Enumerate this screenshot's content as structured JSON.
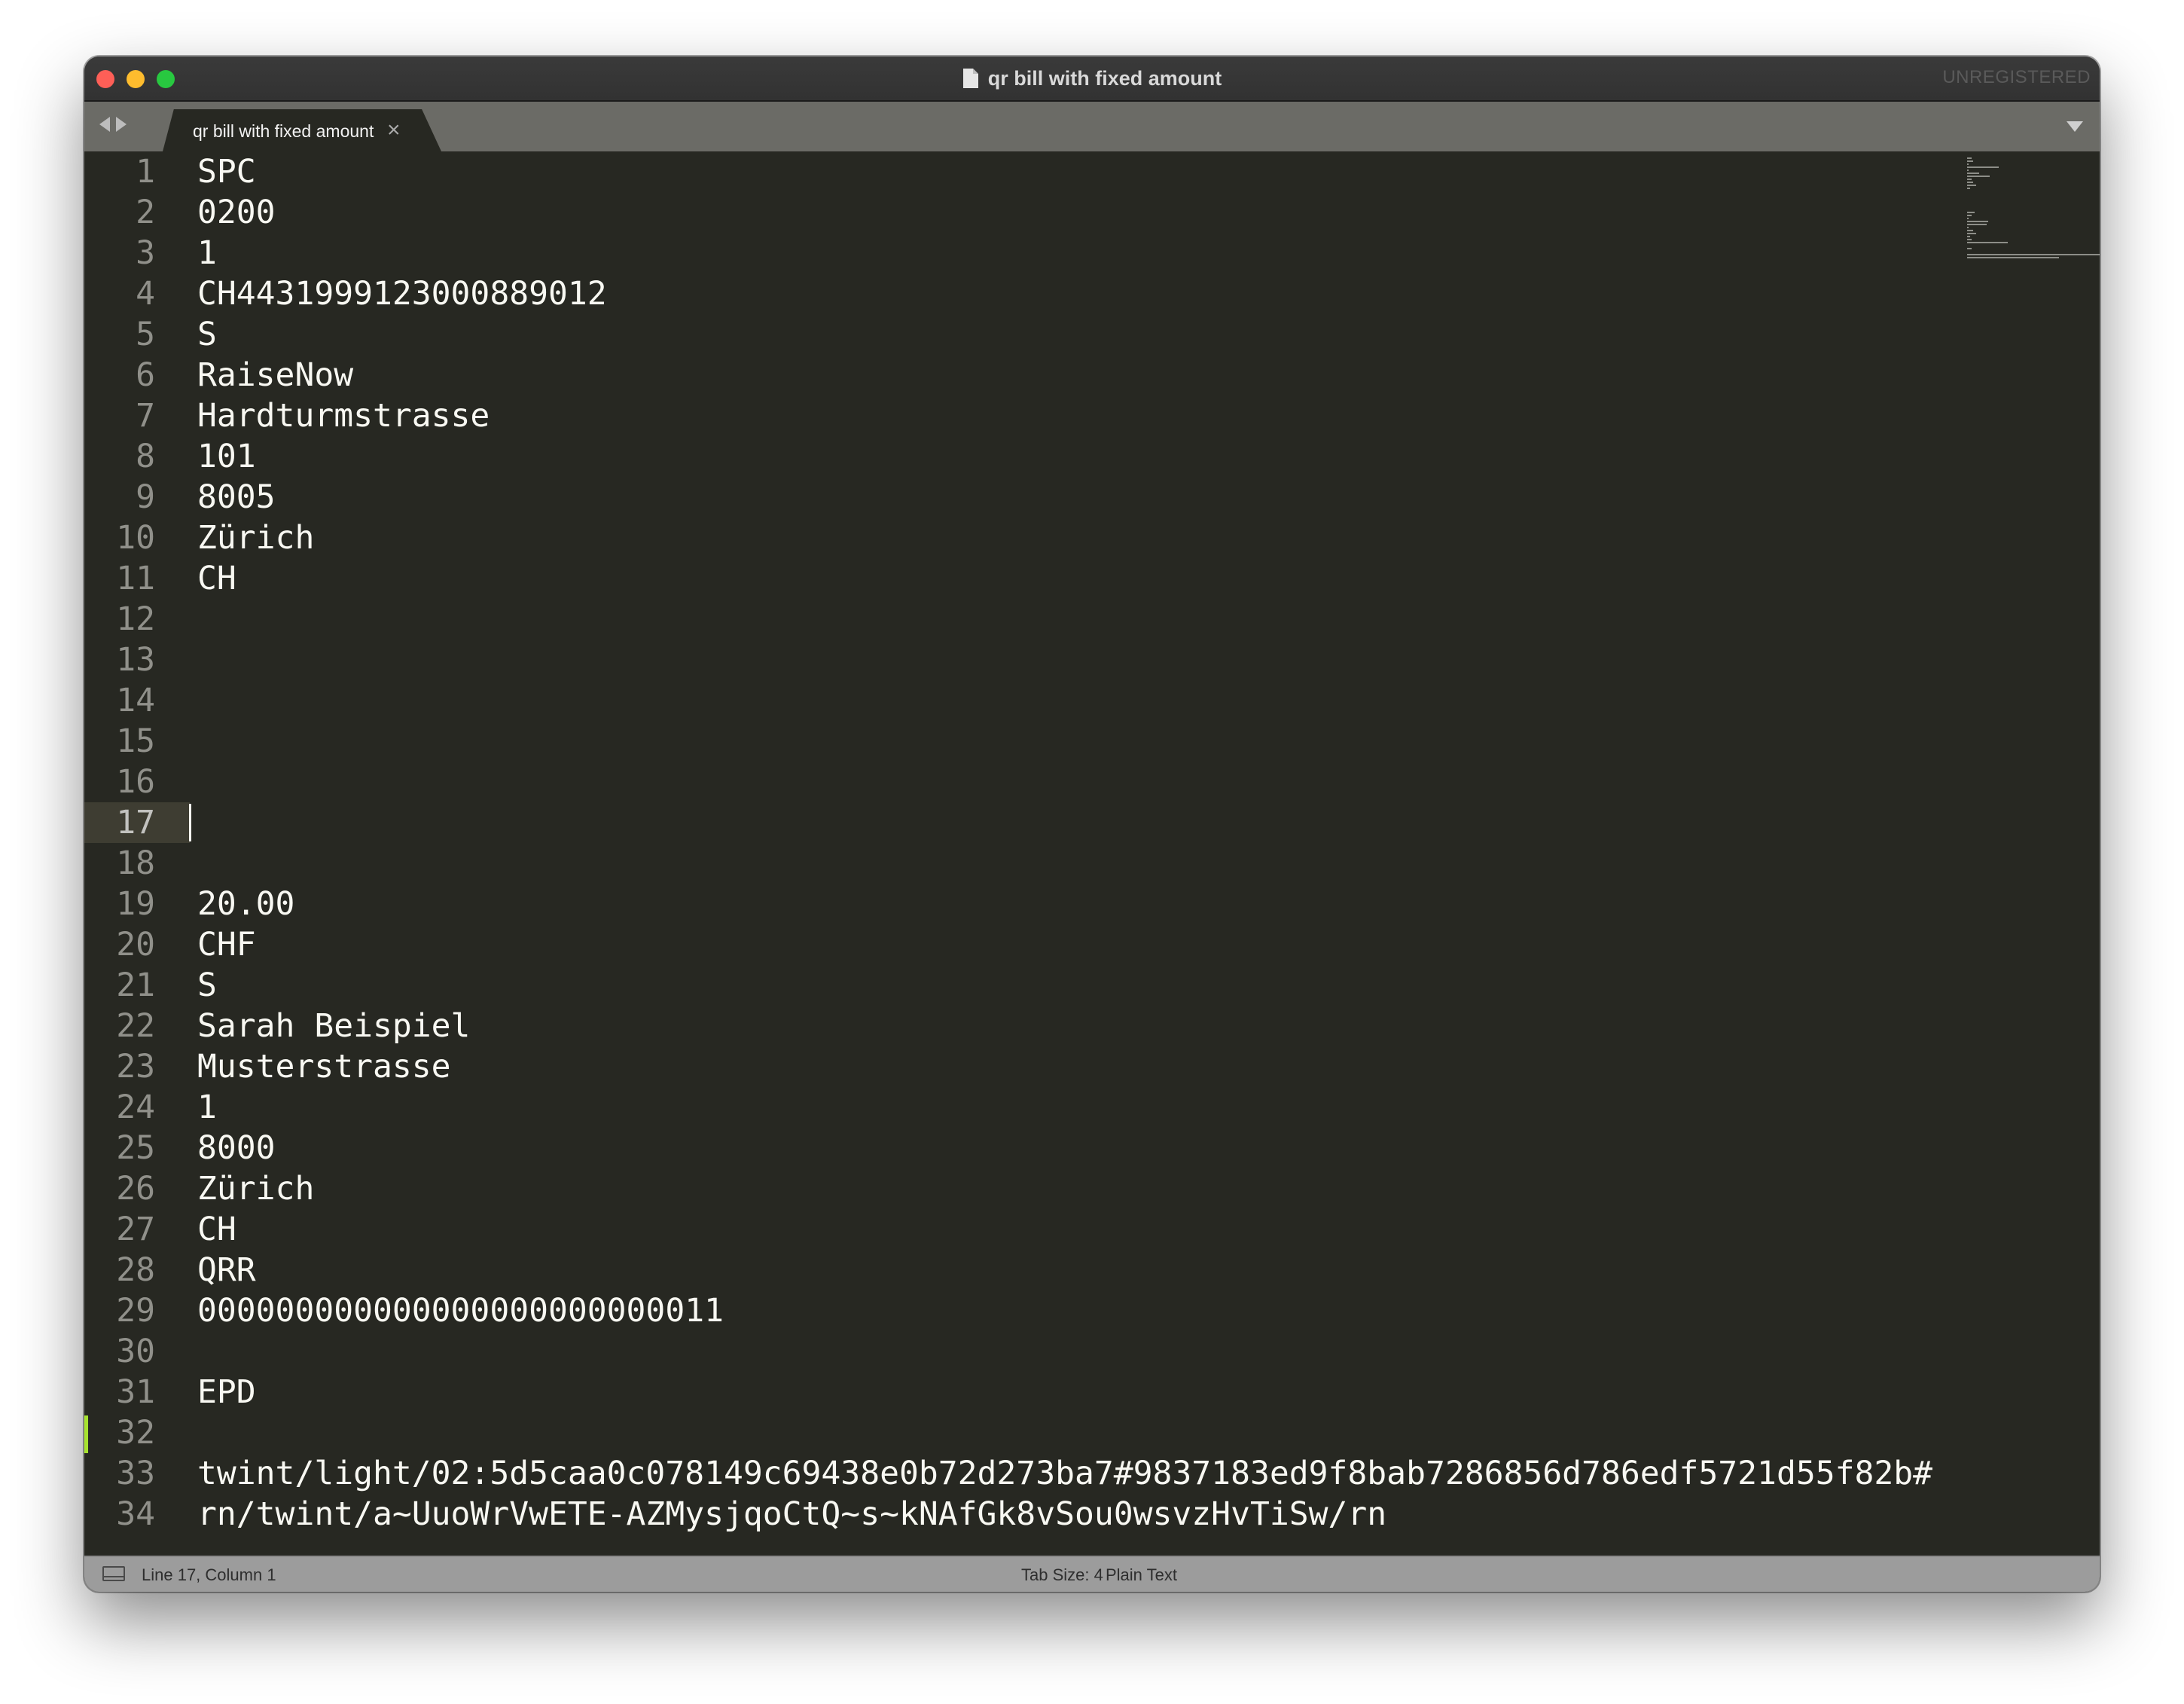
{
  "window": {
    "title": "qr bill with fixed amount",
    "unregistered_label": "UNREGISTERED"
  },
  "tabs": [
    {
      "label": "qr bill with fixed amount",
      "close_glyph": "×"
    }
  ],
  "editor": {
    "current_line": 17,
    "lines": [
      {
        "n": "1",
        "text": "SPC"
      },
      {
        "n": "2",
        "text": "0200"
      },
      {
        "n": "3",
        "text": "1"
      },
      {
        "n": "4",
        "text": "CH4431999123000889012"
      },
      {
        "n": "5",
        "text": "S"
      },
      {
        "n": "6",
        "text": "RaiseNow"
      },
      {
        "n": "7",
        "text": "Hardturmstrasse"
      },
      {
        "n": "8",
        "text": "101"
      },
      {
        "n": "9",
        "text": "8005"
      },
      {
        "n": "10",
        "text": "Zürich"
      },
      {
        "n": "11",
        "text": "CH"
      },
      {
        "n": "12",
        "text": ""
      },
      {
        "n": "13",
        "text": ""
      },
      {
        "n": "14",
        "text": ""
      },
      {
        "n": "15",
        "text": ""
      },
      {
        "n": "16",
        "text": ""
      },
      {
        "n": "17",
        "text": ""
      },
      {
        "n": "18",
        "text": ""
      },
      {
        "n": "19",
        "text": "20.00"
      },
      {
        "n": "20",
        "text": "CHF"
      },
      {
        "n": "21",
        "text": "S"
      },
      {
        "n": "22",
        "text": "Sarah Beispiel"
      },
      {
        "n": "23",
        "text": "Musterstrasse"
      },
      {
        "n": "24",
        "text": "1"
      },
      {
        "n": "25",
        "text": "8000"
      },
      {
        "n": "26",
        "text": "Zürich"
      },
      {
        "n": "27",
        "text": "CH"
      },
      {
        "n": "28",
        "text": "QRR"
      },
      {
        "n": "29",
        "text": "000000000000000000000000011"
      },
      {
        "n": "30",
        "text": ""
      },
      {
        "n": "31",
        "text": "EPD"
      },
      {
        "n": "32",
        "text": ""
      },
      {
        "n": "33",
        "text": "twint/light/02:5d5caa0c078149c69438e0b72d273ba7#9837183ed9f8bab7286856d786edf5721d55f82b#"
      },
      {
        "n": "34",
        "text": "rn/twint/a~UuoWrVwETE-AZMysjqoCtQ~s~kNAfGk8vSou0wsvzHvTiSw/rn"
      }
    ]
  },
  "statusbar": {
    "position": "Line 17, Column 1",
    "tab_size": "Tab Size: 4",
    "syntax": "Plain Text"
  },
  "colors": {
    "editor_bg": "#272822",
    "text": "#f8f8f2",
    "gutter_text": "#90908a",
    "current_line_gutter": "#3e3d32",
    "modified_marker": "#a6e22e",
    "tabbar_bg": "#6b6b66",
    "statusbar_bg": "#9c9c9c"
  }
}
